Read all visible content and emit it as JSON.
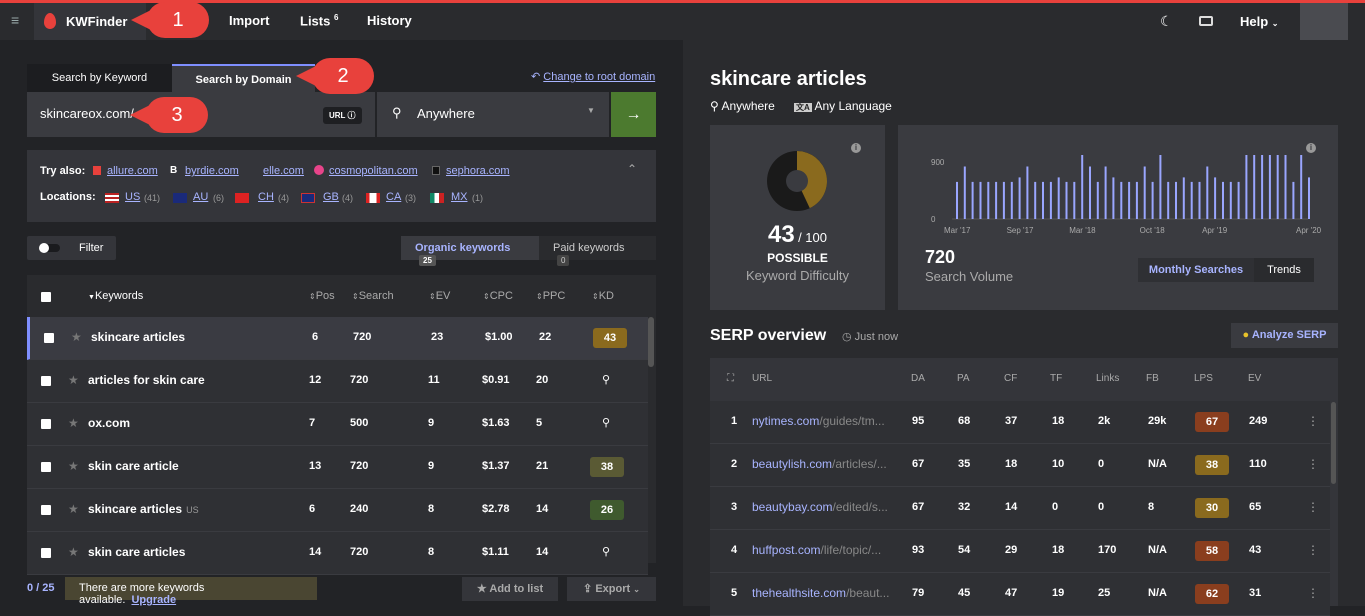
{
  "app": {
    "name": "KWFinder"
  },
  "nav": {
    "import": "Import",
    "lists": "Lists",
    "lists_count": "6",
    "history": "History",
    "help": "Help"
  },
  "callouts": [
    "1",
    "2",
    "3"
  ],
  "search": {
    "tab_keyword": "Search by Keyword",
    "tab_domain": "Search by Domain",
    "change_root": "Change to root domain",
    "value": "skincareox.com/",
    "url_badge": "URL",
    "location": "Anywhere"
  },
  "try_also": {
    "label": "Try also:",
    "sites": [
      "allure.com",
      "byrdie.com",
      "elle.com",
      "cosmopolitan.com",
      "sephora.com"
    ],
    "locations_label": "Locations:",
    "locations": [
      {
        "code": "US",
        "count": "(41)"
      },
      {
        "code": "AU",
        "count": "(6)"
      },
      {
        "code": "CH",
        "count": "(4)"
      },
      {
        "code": "GB",
        "count": "(4)"
      },
      {
        "code": "CA",
        "count": "(3)"
      },
      {
        "code": "MX",
        "count": "(1)"
      }
    ]
  },
  "filter": {
    "label": "Filter",
    "organic": "Organic keywords",
    "organic_count": "25",
    "paid": "Paid keywords",
    "paid_count": "0"
  },
  "table": {
    "headers": [
      "Keywords",
      "Pos",
      "Search",
      "EV",
      "CPC",
      "PPC",
      "KD"
    ],
    "rows": [
      {
        "kw": "skincare articles",
        "suffix": "",
        "pos": "6",
        "search": "720",
        "ev": "23",
        "cpc": "$1.00",
        "ppc": "22",
        "kd": "43",
        "kd_color": "#8a6a1e"
      },
      {
        "kw": "articles for skin care",
        "suffix": "",
        "pos": "12",
        "search": "720",
        "ev": "11",
        "cpc": "$0.91",
        "ppc": "20",
        "kd": "",
        "kd_color": ""
      },
      {
        "kw": "ox.com",
        "suffix": "",
        "pos": "7",
        "search": "500",
        "ev": "9",
        "cpc": "$1.63",
        "ppc": "5",
        "kd": "",
        "kd_color": ""
      },
      {
        "kw": "skin care article",
        "suffix": "",
        "pos": "13",
        "search": "720",
        "ev": "9",
        "cpc": "$1.37",
        "ppc": "21",
        "kd": "38",
        "kd_color": "#5a5a34"
      },
      {
        "kw": "skincare articles",
        "suffix": "US",
        "pos": "6",
        "search": "240",
        "ev": "8",
        "cpc": "$2.78",
        "ppc": "14",
        "kd": "26",
        "kd_color": "#3f5a2e"
      },
      {
        "kw": "skin care articles",
        "suffix": "",
        "pos": "14",
        "search": "720",
        "ev": "8",
        "cpc": "$1.11",
        "ppc": "14",
        "kd": "",
        "kd_color": ""
      }
    ]
  },
  "footer": {
    "count": "0 / 25",
    "more_text": "There are more keywords available.",
    "upgrade": "Upgrade",
    "add_to_list": "Add to list",
    "export": "Export"
  },
  "right": {
    "title": "skincare articles",
    "location": "Anywhere",
    "language": "Any Language",
    "kd_value": "43",
    "kd_max": "/ 100",
    "kd_label": "POSSIBLE",
    "kd_caption": "Keyword Difficulty",
    "kd_fraction": 0.43,
    "volume": "720",
    "volume_caption": "Search Volume",
    "monthly": "Monthly Searches",
    "trends": "Trends"
  },
  "chart_data": {
    "type": "bar",
    "yticks": [
      "900",
      "0"
    ],
    "ylim": [
      0,
      1000
    ],
    "xticks": [
      "Mar '17",
      "Sep '17",
      "Mar '18",
      "Oct '18",
      "Apr '19",
      "Apr '20"
    ],
    "values": [
      580,
      820,
      580,
      580,
      580,
      580,
      580,
      580,
      650,
      820,
      580,
      580,
      580,
      650,
      580,
      580,
      1000,
      820,
      580,
      820,
      650,
      580,
      580,
      580,
      820,
      580,
      1000,
      580,
      580,
      650,
      580,
      580,
      820,
      650,
      580,
      580,
      580,
      1000,
      1000,
      1000,
      1000,
      1000,
      1000,
      580,
      1000,
      650
    ]
  },
  "serp": {
    "title": "SERP overview",
    "time": "Just now",
    "analyze": "Analyze SERP",
    "headers": [
      "URL",
      "DA",
      "PA",
      "CF",
      "TF",
      "Links",
      "FB",
      "LPS",
      "EV"
    ],
    "rows": [
      {
        "n": "1",
        "domain": "nytimes.com",
        "path": "/guides/tm...",
        "da": "95",
        "pa": "68",
        "cf": "37",
        "tf": "18",
        "links": "2k",
        "fb": "29k",
        "lps": "67",
        "lps_color": "#8a3e1e",
        "ev": "249"
      },
      {
        "n": "2",
        "domain": "beautylish.com",
        "path": "/articles/...",
        "da": "67",
        "pa": "35",
        "cf": "18",
        "tf": "10",
        "links": "0",
        "fb": "N/A",
        "lps": "38",
        "lps_color": "#8a6a1e",
        "ev": "110"
      },
      {
        "n": "3",
        "domain": "beautybay.com",
        "path": "/edited/s...",
        "da": "67",
        "pa": "32",
        "cf": "14",
        "tf": "0",
        "links": "0",
        "fb": "8",
        "lps": "30",
        "lps_color": "#8a6a1e",
        "ev": "65"
      },
      {
        "n": "4",
        "domain": "huffpost.com",
        "path": "/life/topic/...",
        "da": "93",
        "pa": "54",
        "cf": "29",
        "tf": "18",
        "links": "170",
        "fb": "N/A",
        "lps": "58",
        "lps_color": "#8a3e1e",
        "ev": "43"
      },
      {
        "n": "5",
        "domain": "thehealthsite.com",
        "path": "/beaut...",
        "da": "79",
        "pa": "45",
        "cf": "47",
        "tf": "19",
        "links": "25",
        "fb": "N/A",
        "lps": "62",
        "lps_color": "#8a3e1e",
        "ev": "31"
      }
    ]
  }
}
